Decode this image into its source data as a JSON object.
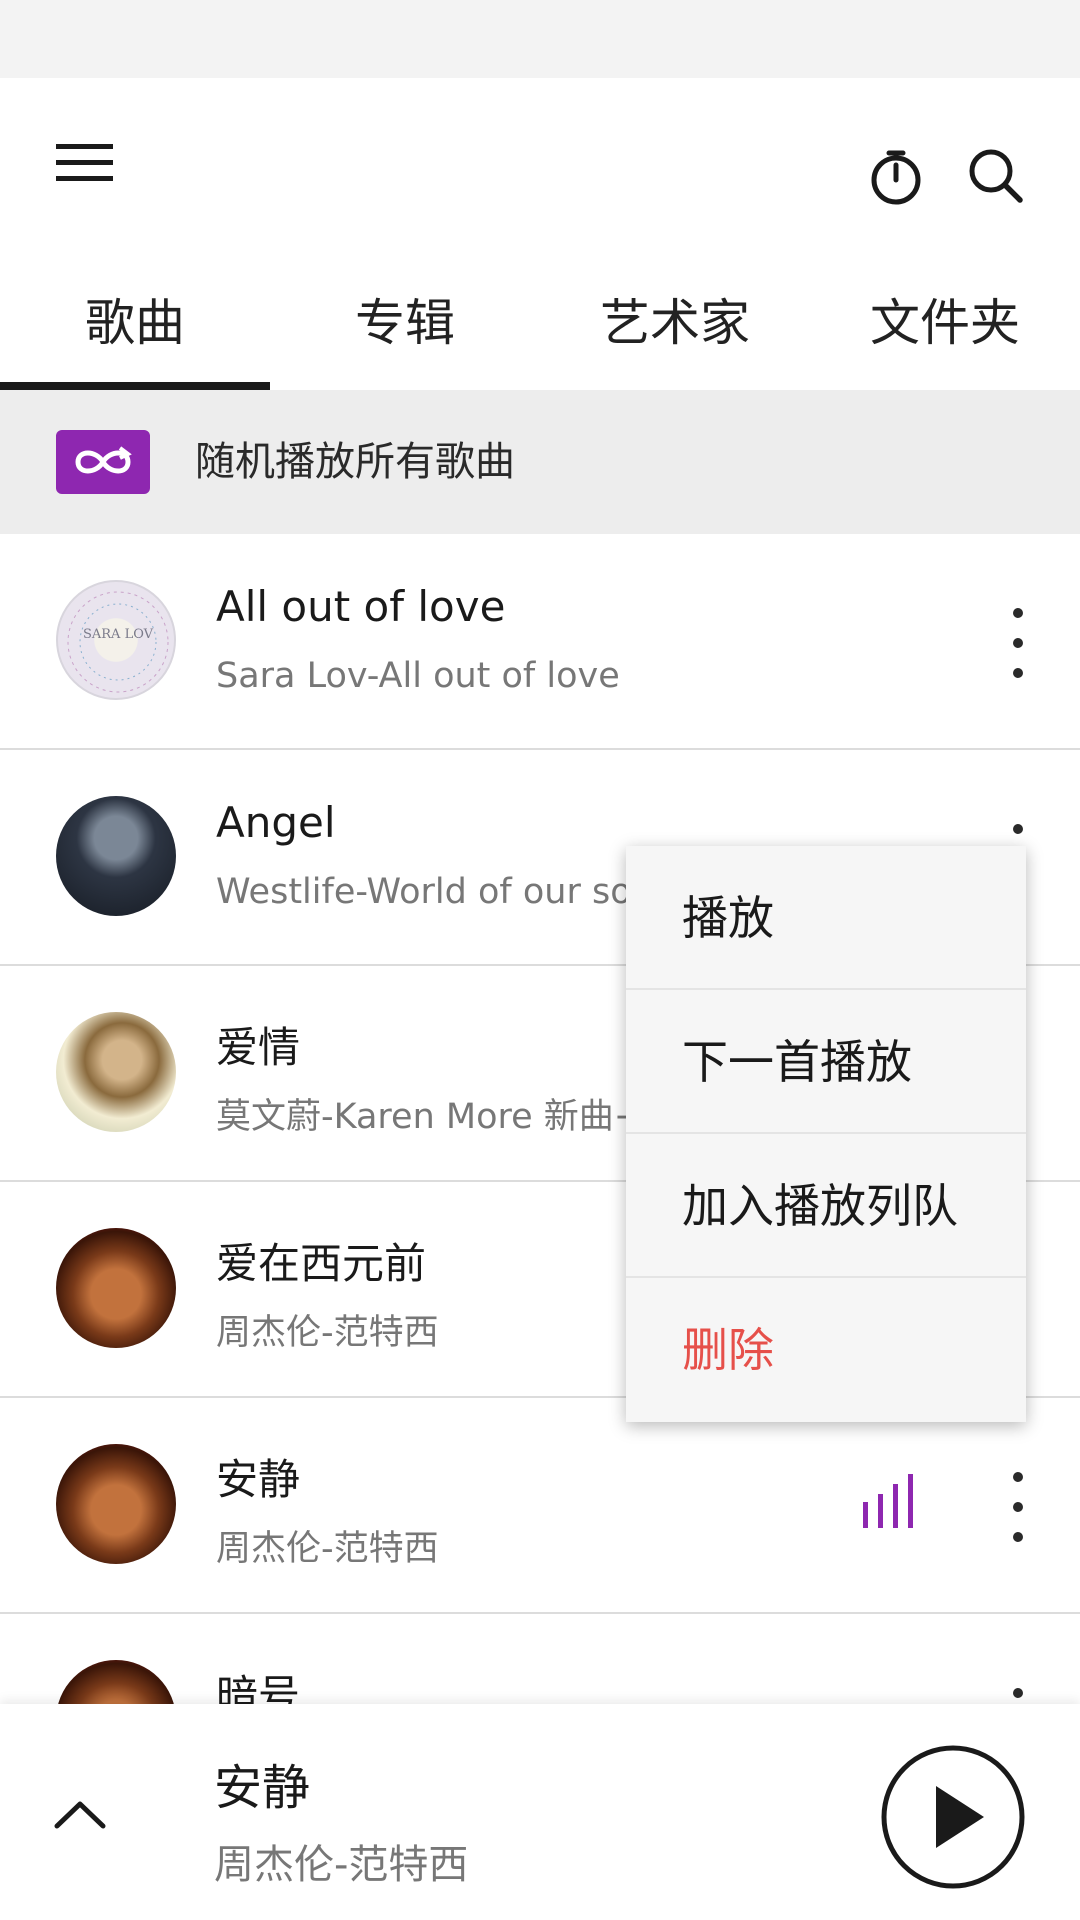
{
  "header": {
    "icons": [
      "menu-icon",
      "timer-icon",
      "search-icon"
    ]
  },
  "tabs": [
    {
      "label": "歌曲",
      "active": true
    },
    {
      "label": "专辑",
      "active": false
    },
    {
      "label": "艺术家",
      "active": false
    },
    {
      "label": "文件夹",
      "active": false
    }
  ],
  "shuffle": {
    "label": "随机播放所有歌曲",
    "icon": "shuffle-icon",
    "accent": "#8e27b0"
  },
  "songs": [
    {
      "title": "All out of love",
      "subtitle": "Sara Lov-All out of love",
      "art_text": "SARA LOV"
    },
    {
      "title": "Angel",
      "subtitle": "Westlife-World of our songs"
    },
    {
      "title": "爱情",
      "subtitle": "莫文蔚-Karen More 新曲+精选"
    },
    {
      "title": "爱在西元前",
      "subtitle": "周杰伦-范特西"
    },
    {
      "title": "安静",
      "subtitle": "周杰伦-范特西",
      "playing": true
    },
    {
      "title": "暗号",
      "subtitle": ""
    }
  ],
  "context_menu": {
    "items": [
      {
        "label": "播放"
      },
      {
        "label": "下一首播放"
      },
      {
        "label": "加入播放列队"
      },
      {
        "label": "删除",
        "color": "#e6504a"
      }
    ]
  },
  "now_playing": {
    "title": "安静",
    "subtitle": "周杰伦-范特西",
    "icons": [
      "chevron-up-icon",
      "play-icon"
    ]
  },
  "colors": {
    "accent": "#8e27b0",
    "danger": "#e6504a",
    "divider": "#dcdcdc"
  }
}
